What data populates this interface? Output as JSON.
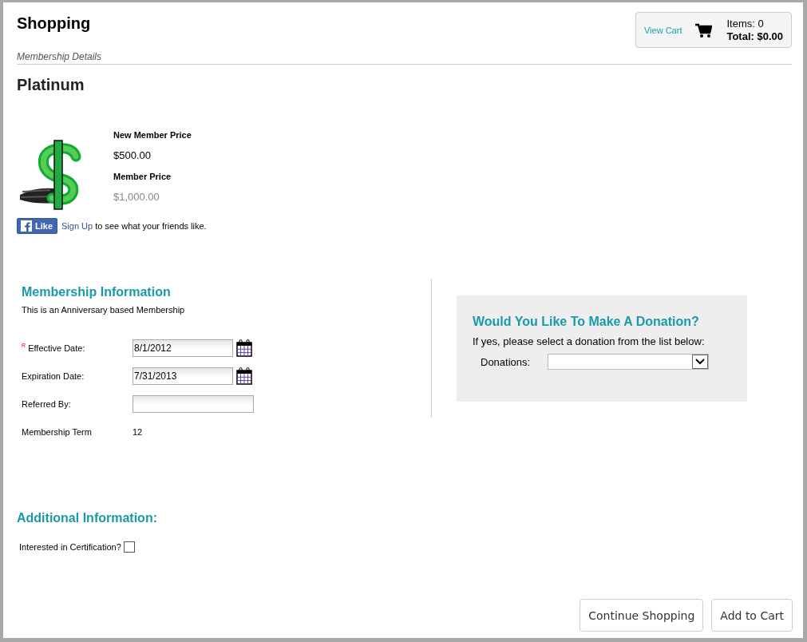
{
  "page": {
    "title": "Shopping",
    "breadcrumb": "Membership Details"
  },
  "cart": {
    "link": "View Cart",
    "items": "Items: 0",
    "total": "Total: $0.00"
  },
  "product": {
    "name": "Platinum",
    "prices": [
      {
        "label": "New Member Price",
        "amount": "$500.00",
        "muted": false
      },
      {
        "label": "Member Price",
        "amount": "$1,000.00",
        "muted": true
      }
    ]
  },
  "social": {
    "like": "Like",
    "link": "Sign Up",
    "text": "to see what your friends like."
  },
  "membership": {
    "heading": "Membership Information",
    "note": "This is an Anniversary based Membership",
    "fields": [
      {
        "kind": "date",
        "label": "Effective Date:",
        "required": true,
        "required_mark": "R",
        "value": "8/1/2012"
      },
      {
        "kind": "date",
        "label": "Expiration Date:",
        "required": false,
        "value": "7/31/2013"
      },
      {
        "kind": "text",
        "label": "Referred By:",
        "required": false
      },
      {
        "kind": "static",
        "label": "Membership Term",
        "required": false,
        "value": "12"
      }
    ]
  },
  "donation": {
    "heading": "Would You Like To Make A Donation?",
    "prompt": "If yes, please select a donation from the list below:",
    "label": "Donations:"
  },
  "additional": {
    "heading": "Additional Information:",
    "checkbox": {
      "label": "Interested in Certification?",
      "checked": false
    }
  },
  "buttons": [
    "Continue Shopping",
    "Add to Cart"
  ]
}
